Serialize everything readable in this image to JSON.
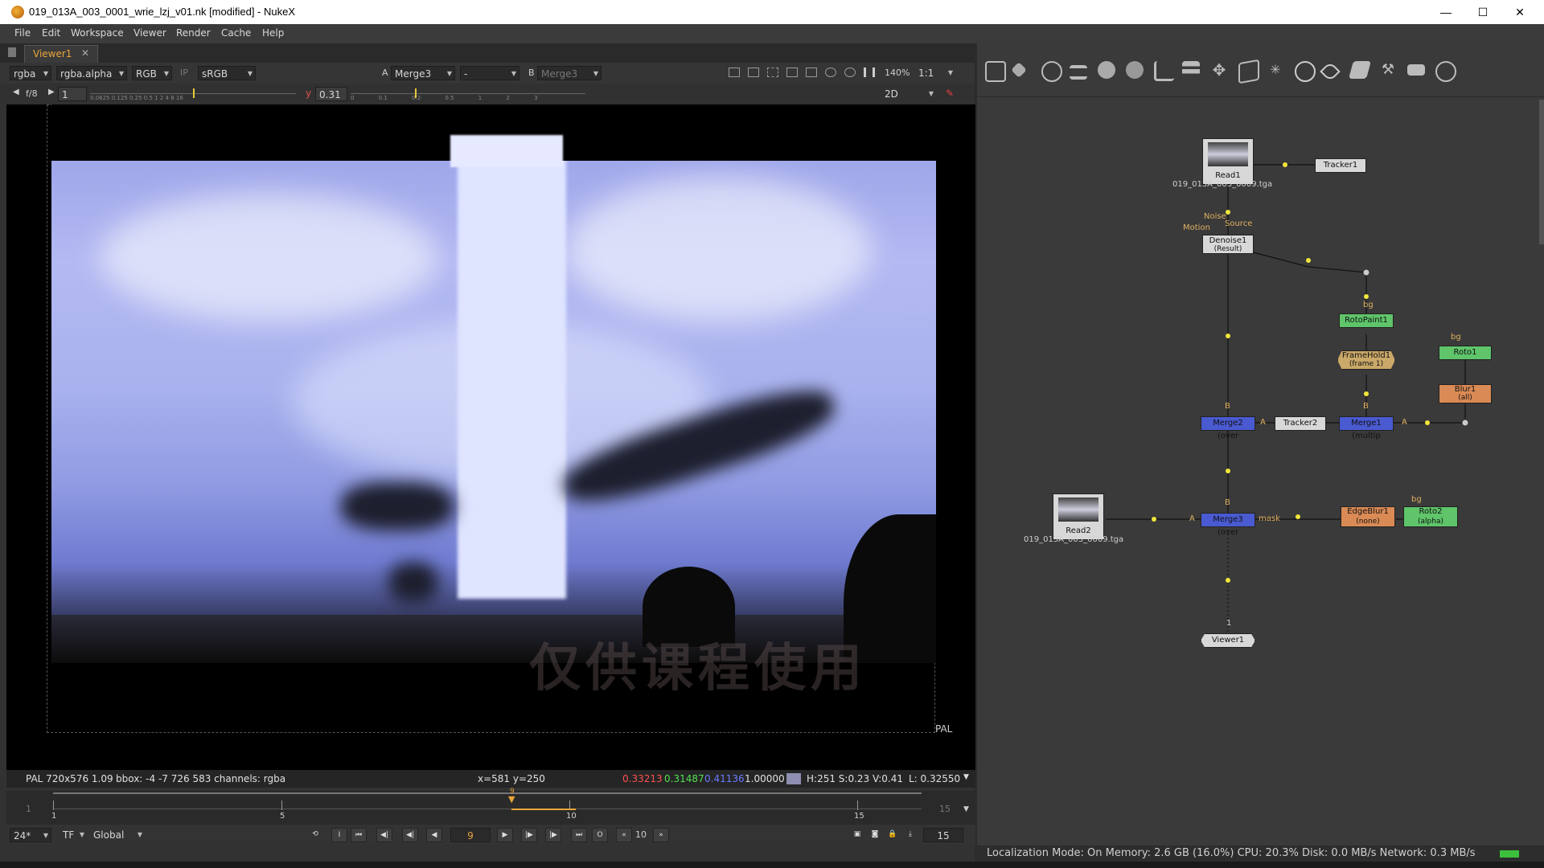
{
  "window": {
    "title": "019_013A_003_0001_wrie_lzj_v01.nk [modified] - NukeX",
    "minimize": "—",
    "maximize": "☐",
    "close": "✕"
  },
  "menu": [
    "File",
    "Edit",
    "Workspace",
    "Viewer",
    "Render",
    "Cache",
    "Help"
  ],
  "viewer": {
    "tab_label": "Viewer1",
    "tab_close": "✕",
    "channels": "rgba",
    "alpha_channel": "rgba.alpha",
    "display": "RGB",
    "ip": "IP",
    "lut": "sRGB",
    "a_label": "A",
    "a_input": "Merge3",
    "dash_input": "-",
    "b_label": "B",
    "b_input": "Merge3",
    "zoom": "140%",
    "proxy": "1:1",
    "fstop_label": "f/8",
    "gain_value": "1",
    "gain_ticks": "0.0625 0.125 0.25 0.5 1 2 4 8 16",
    "gamma_label": "y",
    "gamma_value": "0.31",
    "gamma_ticks": "0 0.1 0.2 0.5 1 2 3",
    "view_mode": "2D",
    "format_corner_label": "PAL",
    "watermark": "仅供课程使用",
    "info": {
      "format": "PAL 720x576 1.09",
      "bbox": "bbox: -4 -7 726 583 channels: rgba",
      "coords": "x=581 y=250",
      "r": "0.33213",
      "g": "0.31487",
      "b": "0.41136",
      "a": "1.00000",
      "hsv": "H:251 S:0.23 V:0.41",
      "luma": "L: 0.32550"
    },
    "timeline": {
      "start": "1",
      "end": "15",
      "ticks": [
        "1",
        "5",
        "10",
        "15"
      ],
      "current_marker": "9"
    },
    "playback": {
      "fps": "24*",
      "tf": "TF",
      "global": "Global",
      "in_btn": "I",
      "out_btn": "O",
      "current_frame": "9",
      "skip_frames": "10",
      "end_frame": "15"
    }
  },
  "nodes": {
    "read1": {
      "name": "Read1",
      "file": "019_013A_003_0009.tga"
    },
    "read2": {
      "name": "Read2",
      "file": "019_013A_003_0009.tga"
    },
    "tracker1": "Tracker1",
    "tracker2": "Tracker2",
    "denoise1": {
      "name": "Denoise1",
      "sub": "(Result)"
    },
    "denoise_inputs": {
      "noise": "Noise",
      "source": "Source",
      "motion": "Motion"
    },
    "rotopaint1": "RotoPaint1",
    "framehold1": {
      "name": "FrameHold1",
      "sub": "(frame 1)"
    },
    "roto1": "Roto1",
    "roto2": {
      "name": "Roto2",
      "sub": "(alpha)"
    },
    "blur1": {
      "name": "Blur1",
      "sub": "(all)"
    },
    "edgeblur1": {
      "name": "EdgeBlur1",
      "sub": "(none)"
    },
    "merge1": "Merge1 (multip",
    "merge2": "Merge2 (over",
    "merge3": "Merge3 (over",
    "viewer1": "Viewer1",
    "pipe_labels": {
      "bg": "bg",
      "b": "B",
      "a": "A",
      "mask": "mask",
      "one": "1"
    }
  },
  "status": {
    "text": "Localization Mode: On Memory: 2.6 GB (16.0%) CPU: 20.3% Disk: 0.0 MB/s Network: 0.3 MB/s"
  },
  "colors": {
    "read_node": "#d8d8d8",
    "merge_node": "#4a5ad0",
    "roto_node": "#5fc46a",
    "blur_node": "#d98a55",
    "framehold_node": "#c9a868",
    "accent_orange": "#e8a63a"
  }
}
